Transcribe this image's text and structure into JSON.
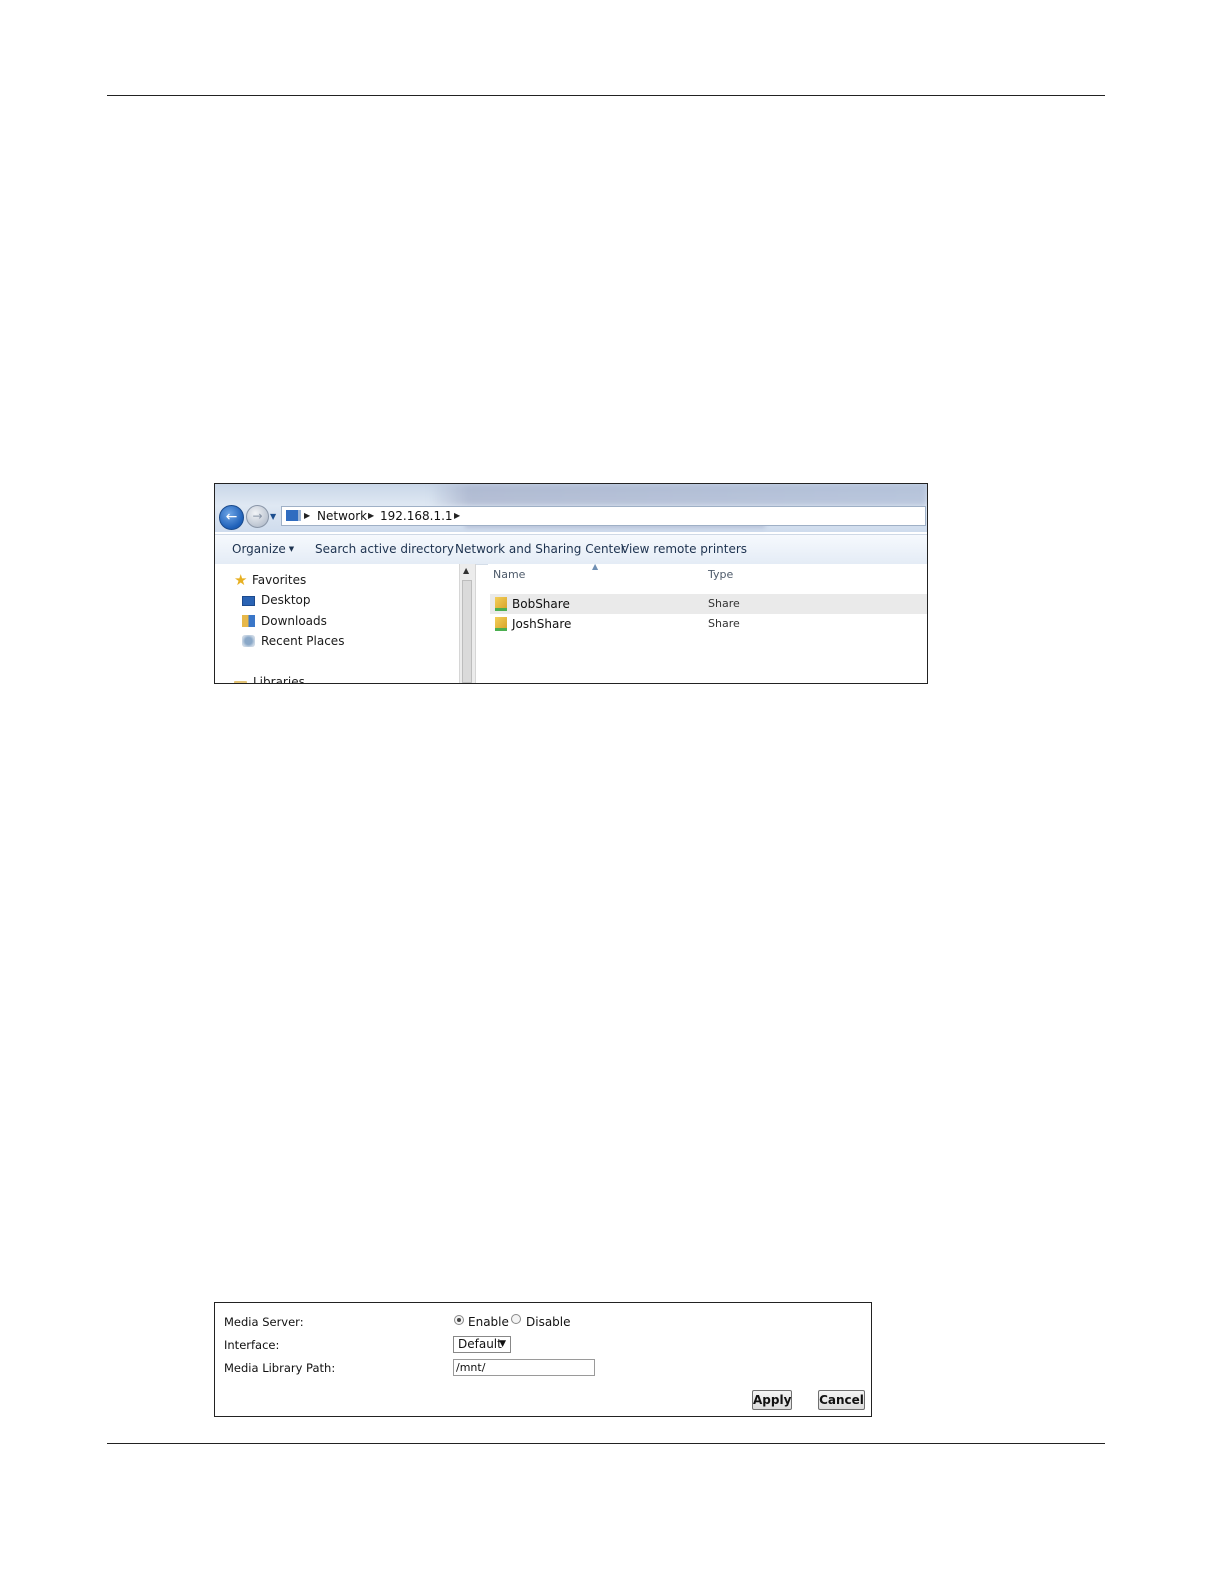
{
  "explorer": {
    "breadcrumb": [
      "Network",
      "192.168.1.1"
    ],
    "toolbar": {
      "organize": "Organize",
      "search_ad": "Search active directory",
      "network_center": "Network and Sharing Center",
      "remote_printers": "View remote printers"
    },
    "nav": {
      "favorites": "Favorites",
      "desktop": "Desktop",
      "downloads": "Downloads",
      "recent": "Recent Places",
      "libraries": "Libraries"
    },
    "columns": {
      "name": "Name",
      "type": "Type"
    },
    "files": [
      {
        "name": "BobShare",
        "type": "Share"
      },
      {
        "name": "JoshShare",
        "type": "Share"
      }
    ]
  },
  "media_form": {
    "media_server_label": "Media Server:",
    "enable_label": "Enable",
    "disable_label": "Disable",
    "selected": "Enable",
    "interface_label": "Interface:",
    "interface_value": "Default",
    "library_path_label": "Media Library Path:",
    "library_path_value": "/mnt/",
    "apply_label": "Apply",
    "cancel_label": "Cancel"
  }
}
